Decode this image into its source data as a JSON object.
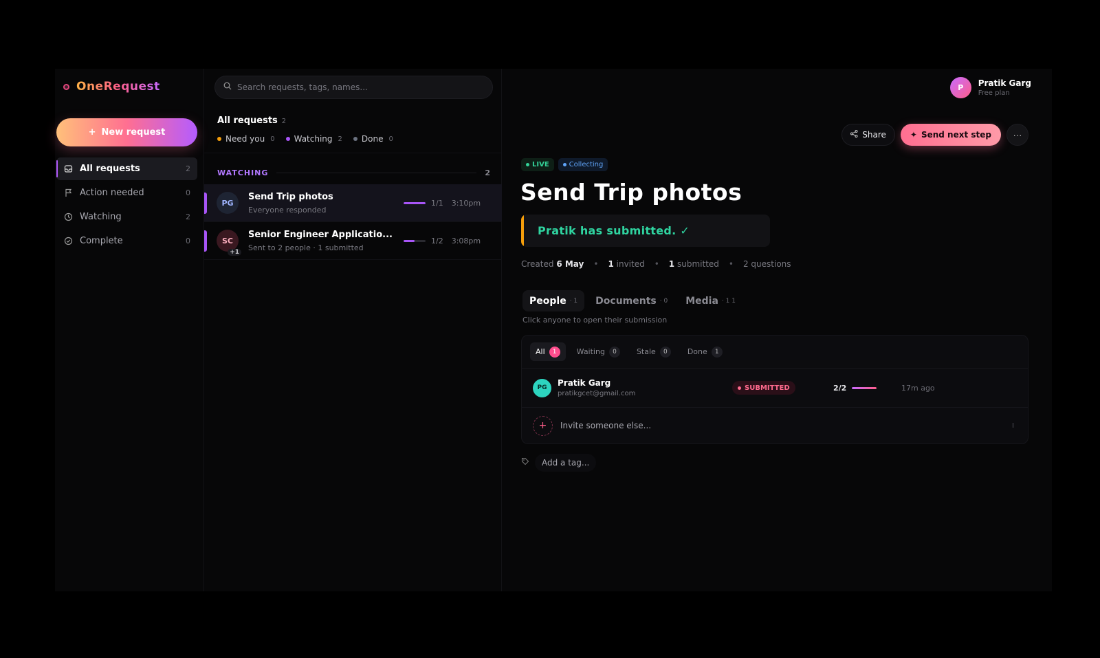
{
  "app": {
    "name": "OneRequest"
  },
  "sidebar": {
    "new_request": "New request",
    "items": [
      {
        "label": "All requests",
        "count": "2"
      },
      {
        "label": "Action needed",
        "count": "0"
      },
      {
        "label": "Watching",
        "count": "2"
      },
      {
        "label": "Complete",
        "count": "0"
      }
    ]
  },
  "search": {
    "placeholder": "Search requests, tags, names..."
  },
  "list": {
    "title": "All requests",
    "count": "2",
    "filters": [
      {
        "label": "Need you",
        "count": "0",
        "color": "#f59e0b"
      },
      {
        "label": "Watching",
        "count": "2",
        "color": "#a855f7"
      },
      {
        "label": "Done",
        "count": "0",
        "color": "#6b7280"
      }
    ],
    "section": {
      "label": "WATCHING",
      "count": "2"
    },
    "rows": [
      {
        "initials": "PG",
        "extra": "",
        "title": "Send Trip photos",
        "subtitle": "Everyone responded",
        "progress_text": "1/1",
        "progress": 1.0,
        "time": "3:10pm",
        "avatar_bg": "#1e2433",
        "avatar_fg": "#9fb4ff"
      },
      {
        "initials": "SC",
        "extra": "+1",
        "title": "Senior Engineer Applicatio...",
        "subtitle": "Sent to 2 people · 1 submitted",
        "progress_text": "1/2",
        "progress": 0.5,
        "time": "3:08pm",
        "avatar_bg": "#3a1820",
        "avatar_fg": "#ffb0c0"
      }
    ]
  },
  "user": {
    "initial": "P",
    "name": "Pratik Garg",
    "plan": "Free plan"
  },
  "detail": {
    "actions": {
      "share": "Share",
      "next": "Send next step",
      "more": "···"
    },
    "badges": {
      "live": "LIVE",
      "collecting": "Collecting"
    },
    "title": "Send Trip photos",
    "banner": "Pratik has submitted. ✓",
    "meta": {
      "created_label": "Created",
      "created_value": "6 May",
      "invited_num": "1",
      "invited_label": "invited",
      "submitted_num": "1",
      "submitted_label": "submitted",
      "questions": "2 questions"
    },
    "tabs": [
      {
        "label": "People",
        "count": "· 1"
      },
      {
        "label": "Documents",
        "count": "· 0"
      },
      {
        "label": "Media",
        "count": "· 1 1"
      }
    ],
    "hint": "Click anyone to open their submission",
    "subtabs": [
      {
        "label": "All",
        "count": "1"
      },
      {
        "label": "Waiting",
        "count": "0"
      },
      {
        "label": "Stale",
        "count": "0"
      },
      {
        "label": "Done",
        "count": "1"
      }
    ],
    "person": {
      "initials": "PG",
      "name": "Pratik Garg",
      "email": "pratikgcet@gmail.com",
      "status": "SUBMITTED",
      "progress_text": "2/2",
      "progress": 1.0,
      "time": "17m ago"
    },
    "invite": {
      "label": "Invite someone else...",
      "shortcut": "I"
    },
    "tag": "Add a tag..."
  }
}
